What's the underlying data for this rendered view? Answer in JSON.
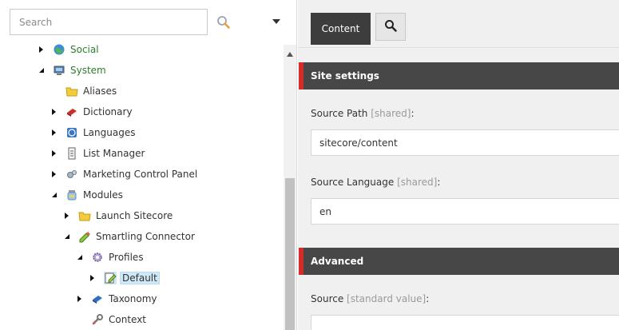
{
  "search": {
    "placeholder": "Search"
  },
  "tree": {
    "items": [
      {
        "label": "Social",
        "icon": "globe-icon",
        "expander": "collapsed"
      },
      {
        "label": "System",
        "icon": "computer-icon",
        "expander": "expanded"
      },
      {
        "label": "Aliases",
        "icon": "folder-icon",
        "expander": "none"
      },
      {
        "label": "Dictionary",
        "icon": "book-icon",
        "expander": "collapsed"
      },
      {
        "label": "Languages",
        "icon": "language-icon",
        "expander": "collapsed"
      },
      {
        "label": "List Manager",
        "icon": "list-icon",
        "expander": "collapsed"
      },
      {
        "label": "Marketing Control Panel",
        "icon": "gears-icon",
        "expander": "collapsed"
      },
      {
        "label": "Modules",
        "icon": "module-jar-icon",
        "expander": "expanded"
      },
      {
        "label": "Launch Sitecore",
        "icon": "folder-icon",
        "expander": "collapsed"
      },
      {
        "label": "Smartling Connector",
        "icon": "pencil-icon",
        "expander": "expanded"
      },
      {
        "label": "Profiles",
        "icon": "gear-icon",
        "expander": "expanded"
      },
      {
        "label": "Default",
        "icon": "edit-document-icon",
        "expander": "collapsed",
        "selected": true
      },
      {
        "label": "Taxonomy",
        "icon": "book-blue-icon",
        "expander": "collapsed"
      },
      {
        "label": "Context",
        "icon": "wrench-icon",
        "expander": "none"
      }
    ]
  },
  "editor": {
    "tabs": {
      "content_label": "Content"
    },
    "sections": {
      "site_settings": "Site settings",
      "advanced": "Advanced"
    },
    "fields": {
      "source_path": {
        "label": "Source Path",
        "meta": "[shared]",
        "colon": ":",
        "value": "sitecore/content"
      },
      "source_language": {
        "label": "Source Language",
        "meta": "[shared]",
        "colon": ":",
        "value": "en"
      },
      "source": {
        "label": "Source",
        "meta": "[standard value]",
        "colon": ":",
        "value": ""
      }
    }
  },
  "colors": {
    "section_bg": "#474747",
    "section_accent": "#d62b2b",
    "tree_green": "#2c7c2c",
    "selected_bg": "#cfe8f6"
  }
}
